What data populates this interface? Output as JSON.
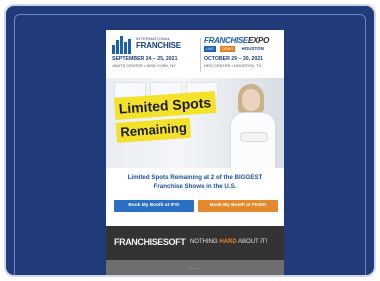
{
  "header": {
    "left": {
      "small_title": "INTERNATIONAL",
      "brand": "FRANCHISE",
      "date": "SEPTEMBER 24 – 25, 2021",
      "venue": "JAVITS CENTER • NEW YORK, NY"
    },
    "right": {
      "brand_part1": "FRANCHISE",
      "brand_part2": "EXPO",
      "tag1": "LIVE",
      "tag2": "DEMO",
      "tag3": "HOUSTON",
      "date": "OCTOBER 29 – 30, 2021",
      "venue": "NRG CENTER • HOUSTON, TX"
    }
  },
  "hero": {
    "banner_line1": "Limited Spots",
    "banner_line2": "Remaining"
  },
  "message": {
    "line1": "Limited Spots Remaining at 2 of the BIGGEST",
    "line2": "Franchise Shows in the U.S.",
    "button_ifs": "Book My Booth at IFS!",
    "button_fe": "Book My Booth at FESH!"
  },
  "footer": {
    "brand_a": "FRANCHISE",
    "brand_b": "SOFT",
    "tagline_pre": "NOTHING ",
    "tagline_hard": "HARD",
    "tagline_post": " ABOUT IT!"
  },
  "sub_footer": {
    "text": "— — —"
  },
  "colors": {
    "page_bg": "#203a7a",
    "accent_blue": "#1b4fa0",
    "accent_orange": "#e58a2c",
    "banner_yellow": "#f3e12a",
    "footer_dark": "#333333"
  }
}
